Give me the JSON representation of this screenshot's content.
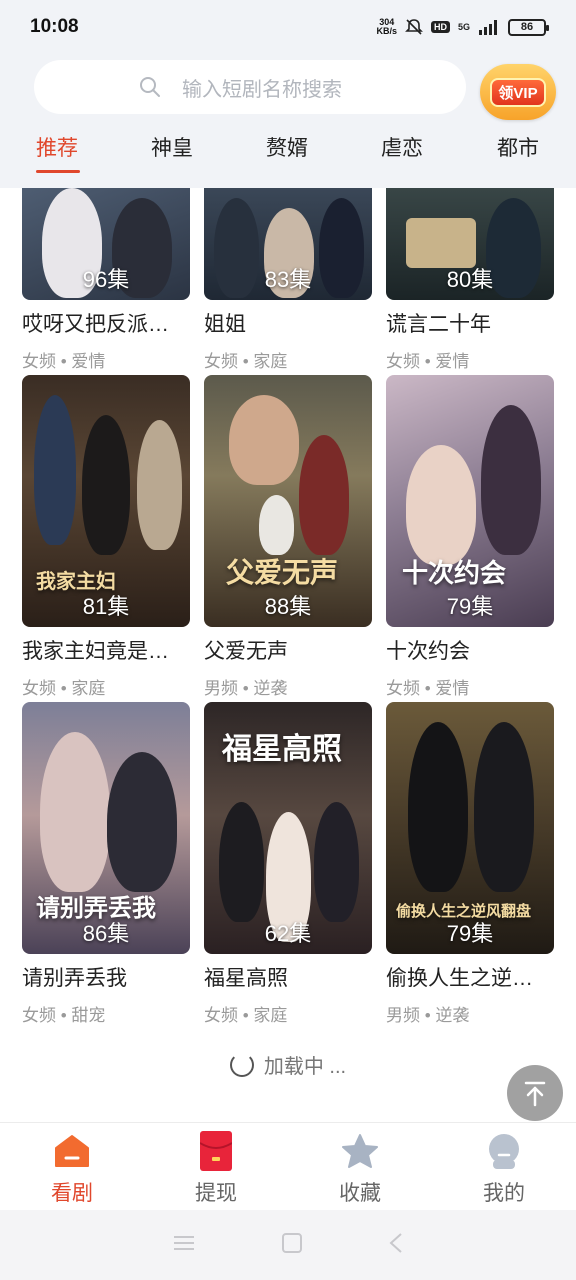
{
  "status": {
    "time": "10:08",
    "net_speed_value": "304",
    "net_speed_unit": "KB/s",
    "hd": "HD",
    "network": "5G",
    "battery": "86"
  },
  "search": {
    "placeholder": "输入短剧名称搜索"
  },
  "vip": {
    "label": "领VIP"
  },
  "tabs": [
    {
      "label": "推荐",
      "active": true
    },
    {
      "label": "神皇"
    },
    {
      "label": "赘婿"
    },
    {
      "label": "虐恋"
    },
    {
      "label": "都市"
    }
  ],
  "dramas": [
    {
      "episodes": "96集",
      "title": "哎呀又把反派…",
      "tags": "女频 • 爱情"
    },
    {
      "episodes": "83集",
      "title": "姐姐",
      "tags": "女频 • 家庭"
    },
    {
      "episodes": "80集",
      "title": "谎言二十年",
      "tags": "女频 • 爱情"
    },
    {
      "episodes": "81集",
      "title": "我家主妇竟是…",
      "tags": "女频 • 家庭",
      "poster_text": "我家主妇"
    },
    {
      "episodes": "88集",
      "title": "父爱无声",
      "tags": "男频 • 逆袭",
      "poster_text": "父爱无声"
    },
    {
      "episodes": "79集",
      "title": "十次约会",
      "tags": "女频 • 爱情",
      "poster_text": "十次约会"
    },
    {
      "episodes": "86集",
      "title": "请别弄丢我",
      "tags": "女频 • 甜宠",
      "poster_text": "请别弄丢我"
    },
    {
      "episodes": "62集",
      "title": "福星高照",
      "tags": "女频 • 家庭",
      "poster_text": "福星高照"
    },
    {
      "episodes": "79集",
      "title": "偷换人生之逆…",
      "tags": "男频 • 逆袭",
      "poster_text": "偷换人生之逆风翻盘"
    }
  ],
  "loading_text": "加载中 ...",
  "bottom_nav": [
    {
      "label": "看剧",
      "icon": "home-icon",
      "active": true
    },
    {
      "label": "提现",
      "icon": "red-envelope-icon"
    },
    {
      "label": "收藏",
      "icon": "star-icon"
    },
    {
      "label": "我的",
      "icon": "profile-icon"
    }
  ],
  "colors": {
    "accent": "#e0472c",
    "header_bg": "#f1f3f7"
  }
}
